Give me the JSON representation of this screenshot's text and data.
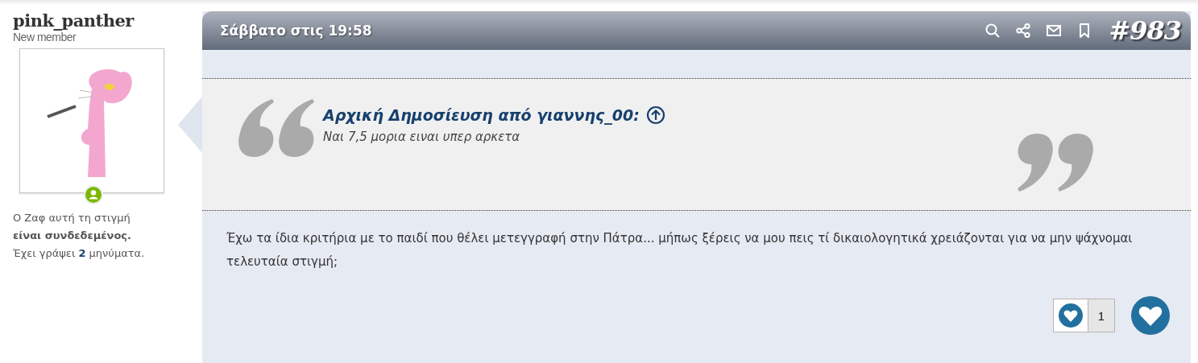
{
  "user": {
    "name": "pink_panther",
    "rank": "New member",
    "online": true,
    "status_text": "Ο Ζαφ αυτή τη στιγμή **είναι συνδεδεμένος.**",
    "posts_text": "Έχει γράψει **2** μηνύματα."
  },
  "post": {
    "date": "Σάββατο στις 19:58",
    "number": "#983",
    "quote": {
      "source": "Αρχική Δημοσίευση από γιαννης_00:",
      "text": "Ναι 7,5 μορια ειναι υπερ αρκετα"
    },
    "body": "Έχω τα ίδια κριτήρια με το παιδί που θέλει μετεγγραφή στην Πάτρα... μήπως ξέρεις να μου πεις τί δικαιολογητικά χρειάζονται για να μην ψάχνομαι τελευταία στιγμή;",
    "likes": {
      "count": "1"
    }
  }
}
